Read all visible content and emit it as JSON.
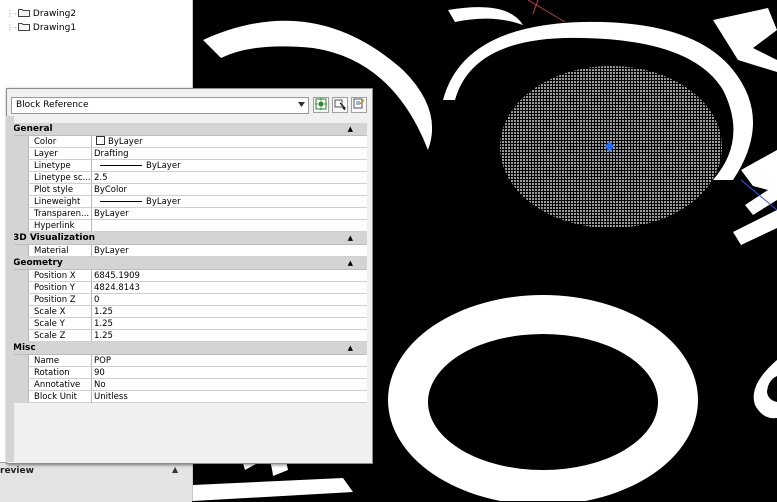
{
  "tree": {
    "items": [
      {
        "label": "Drawing2"
      },
      {
        "label": "Drawing1"
      }
    ],
    "footer_label": "review"
  },
  "palette": {
    "object_type": "Block Reference",
    "sections": [
      {
        "title": "General",
        "rows": [
          {
            "name": "Color",
            "value": "ByLayer",
            "kind": "color"
          },
          {
            "name": "Layer",
            "value": "Drafting"
          },
          {
            "name": "Linetype",
            "value": "ByLayer",
            "kind": "line"
          },
          {
            "name": "Linetype sc...",
            "value": "2.5"
          },
          {
            "name": "Plot style",
            "value": "ByColor"
          },
          {
            "name": "Lineweight",
            "value": "ByLayer",
            "kind": "line"
          },
          {
            "name": "Transparen...",
            "value": "ByLayer"
          },
          {
            "name": "Hyperlink",
            "value": ""
          }
        ]
      },
      {
        "title": "3D Visualization",
        "rows": [
          {
            "name": "Material",
            "value": "ByLayer"
          }
        ]
      },
      {
        "title": "Geometry",
        "rows": [
          {
            "name": "Position X",
            "value": "6845.1909"
          },
          {
            "name": "Position Y",
            "value": "4824.8143"
          },
          {
            "name": "Position Z",
            "value": "0"
          },
          {
            "name": "Scale X",
            "value": "1.25"
          },
          {
            "name": "Scale Y",
            "value": "1.25"
          },
          {
            "name": "Scale Z",
            "value": "1.25"
          }
        ]
      },
      {
        "title": "Misc",
        "rows": [
          {
            "name": "Name",
            "value": "POP"
          },
          {
            "name": "Rotation",
            "value": "90"
          },
          {
            "name": "Annotative",
            "value": "No"
          },
          {
            "name": "Block Unit",
            "value": "Unitless"
          }
        ]
      }
    ]
  },
  "icons": {
    "folder": "folder-icon",
    "quick_select": "quick-select-icon",
    "select_objects": "select-objects-icon",
    "pickadd": "pickadd-toggle-icon"
  },
  "colors": {
    "canvas": "#000000",
    "hatch": "#8a8a8a",
    "grip": "#1e6fff",
    "section_header": "#d4d4d4"
  }
}
